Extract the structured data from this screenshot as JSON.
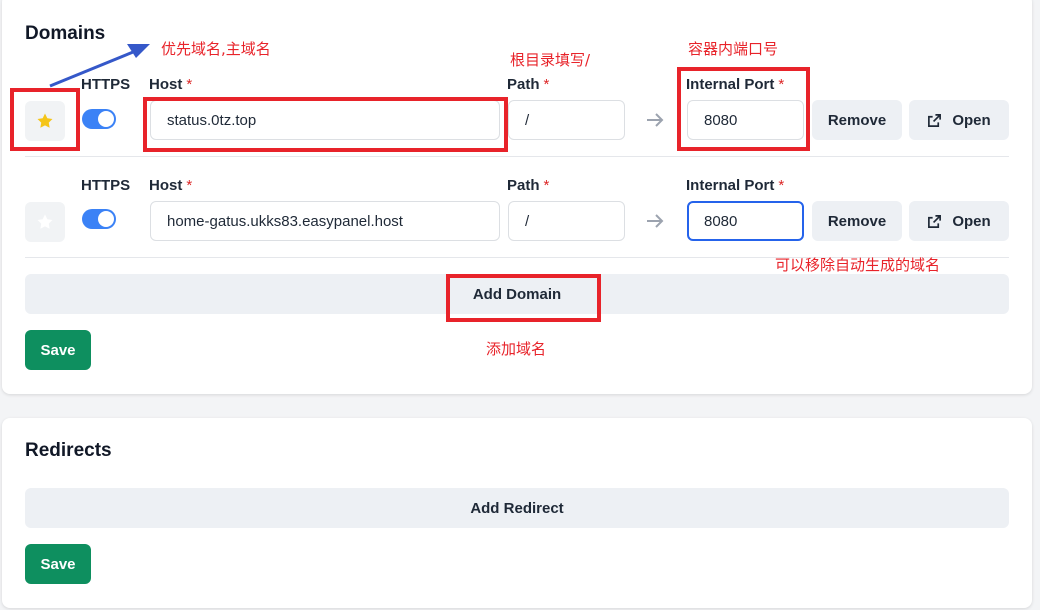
{
  "domains": {
    "title": "Domains",
    "rows": [
      {
        "primary": true,
        "https_label": "HTTPS",
        "host_label": "Host",
        "host_value": "status.0tz.top",
        "path_label": "Path",
        "path_value": "/",
        "port_label": "Internal Port",
        "port_value": "8080",
        "remove_label": "Remove",
        "open_label": "Open"
      },
      {
        "primary": false,
        "https_label": "HTTPS",
        "host_label": "Host",
        "host_value": "home-gatus.ukks83.easypanel.host",
        "path_label": "Path",
        "path_value": "/",
        "port_label": "Internal Port",
        "port_value": "8080",
        "remove_label": "Remove",
        "open_label": "Open"
      }
    ],
    "required_mark": "*",
    "add_label": "Add Domain",
    "save_label": "Save"
  },
  "redirects": {
    "title": "Redirects",
    "add_label": "Add Redirect",
    "save_label": "Save"
  },
  "annotations": {
    "primary_domain": "优先域名,主域名",
    "root_path": "根目录填写/",
    "container_port": "容器内端口号",
    "remove_auto": "可以移除自动生成的域名",
    "add_domain": "添加域名"
  },
  "colors": {
    "accent": "#3b82f6",
    "focus": "#2563eb",
    "save": "#0e8f5f",
    "star_active": "#f5c518",
    "star_inactive": "#ffffff",
    "annotation": "#e8232a",
    "annotation_arrow": "#3558c9"
  }
}
